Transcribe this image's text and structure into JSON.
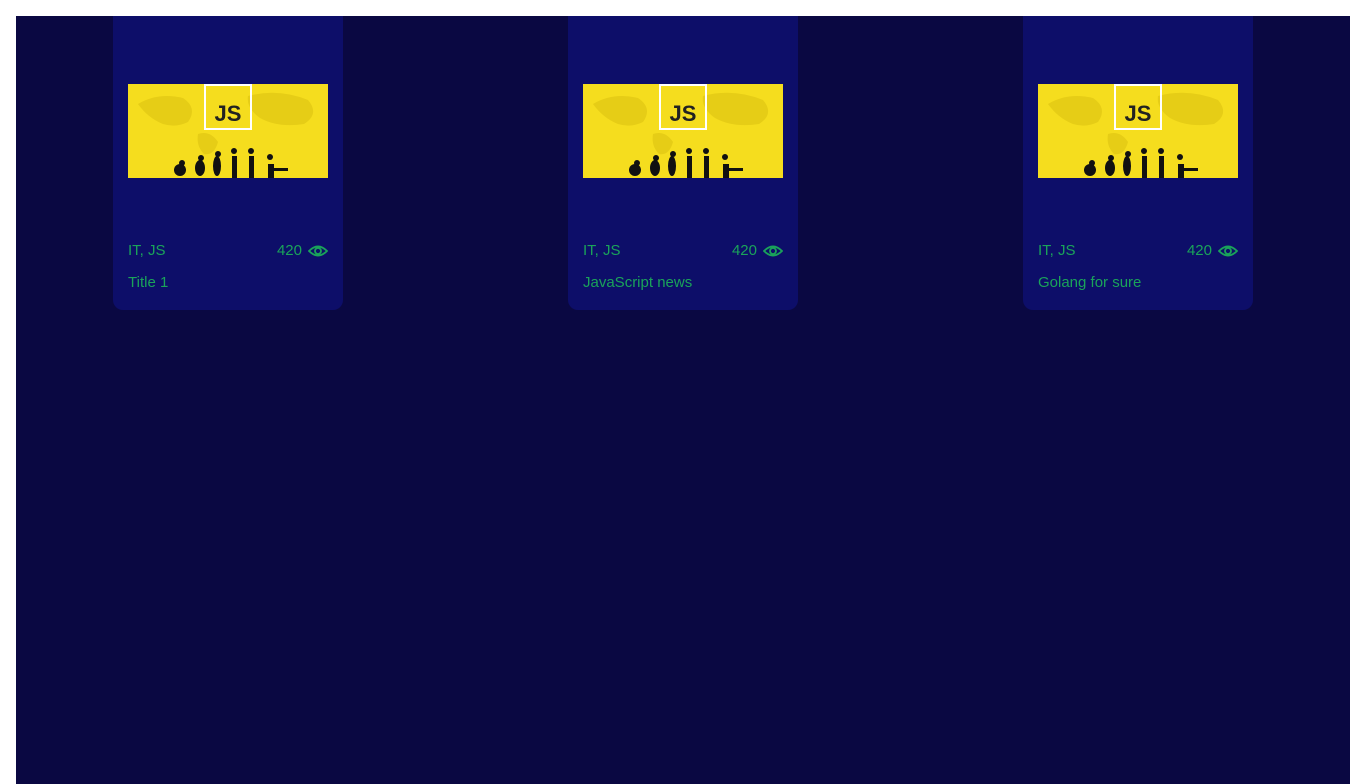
{
  "cards": [
    {
      "tags": "IT, JS",
      "views": "420",
      "title": "Title 1",
      "logo_text": "JS",
      "view_icon": "eye-icon"
    },
    {
      "tags": "IT, JS",
      "views": "420",
      "title": "JavaScript news",
      "logo_text": "JS",
      "view_icon": "eye-icon"
    },
    {
      "tags": "IT, JS",
      "views": "420",
      "title": "Golang for sure",
      "logo_text": "JS",
      "view_icon": "eye-icon"
    }
  ],
  "colors": {
    "page_background": "#0a0842",
    "card_background": "#0d0e69",
    "text_accent": "#1aa35a",
    "thumbnail_yellow": "#f5dd1e"
  }
}
